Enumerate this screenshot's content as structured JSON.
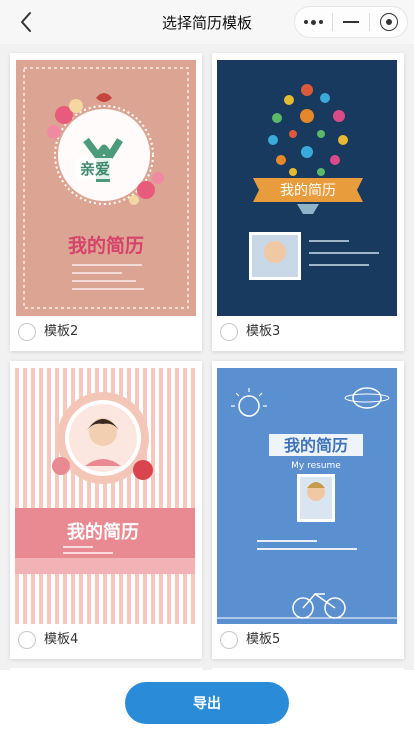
{
  "navbar": {
    "title": "选择简历模板"
  },
  "templates": [
    {
      "label": "模板2",
      "selected": false,
      "heading": "我的简历",
      "badge": "亲爱"
    },
    {
      "label": "模板3",
      "selected": false,
      "heading": "我的简历"
    },
    {
      "label": "模板4",
      "selected": false,
      "heading": "我的简历"
    },
    {
      "label": "模板5",
      "selected": false,
      "heading": "我的简历",
      "subheading": "My resume"
    }
  ],
  "footer": {
    "export_label": "导出"
  },
  "colors": {
    "accent": "#2a8bd8",
    "template3_bg": "#173a5e",
    "template5_bg": "#5a8fd0",
    "template2_bg": "#d9a28f",
    "template4_band": "#e98a92"
  }
}
